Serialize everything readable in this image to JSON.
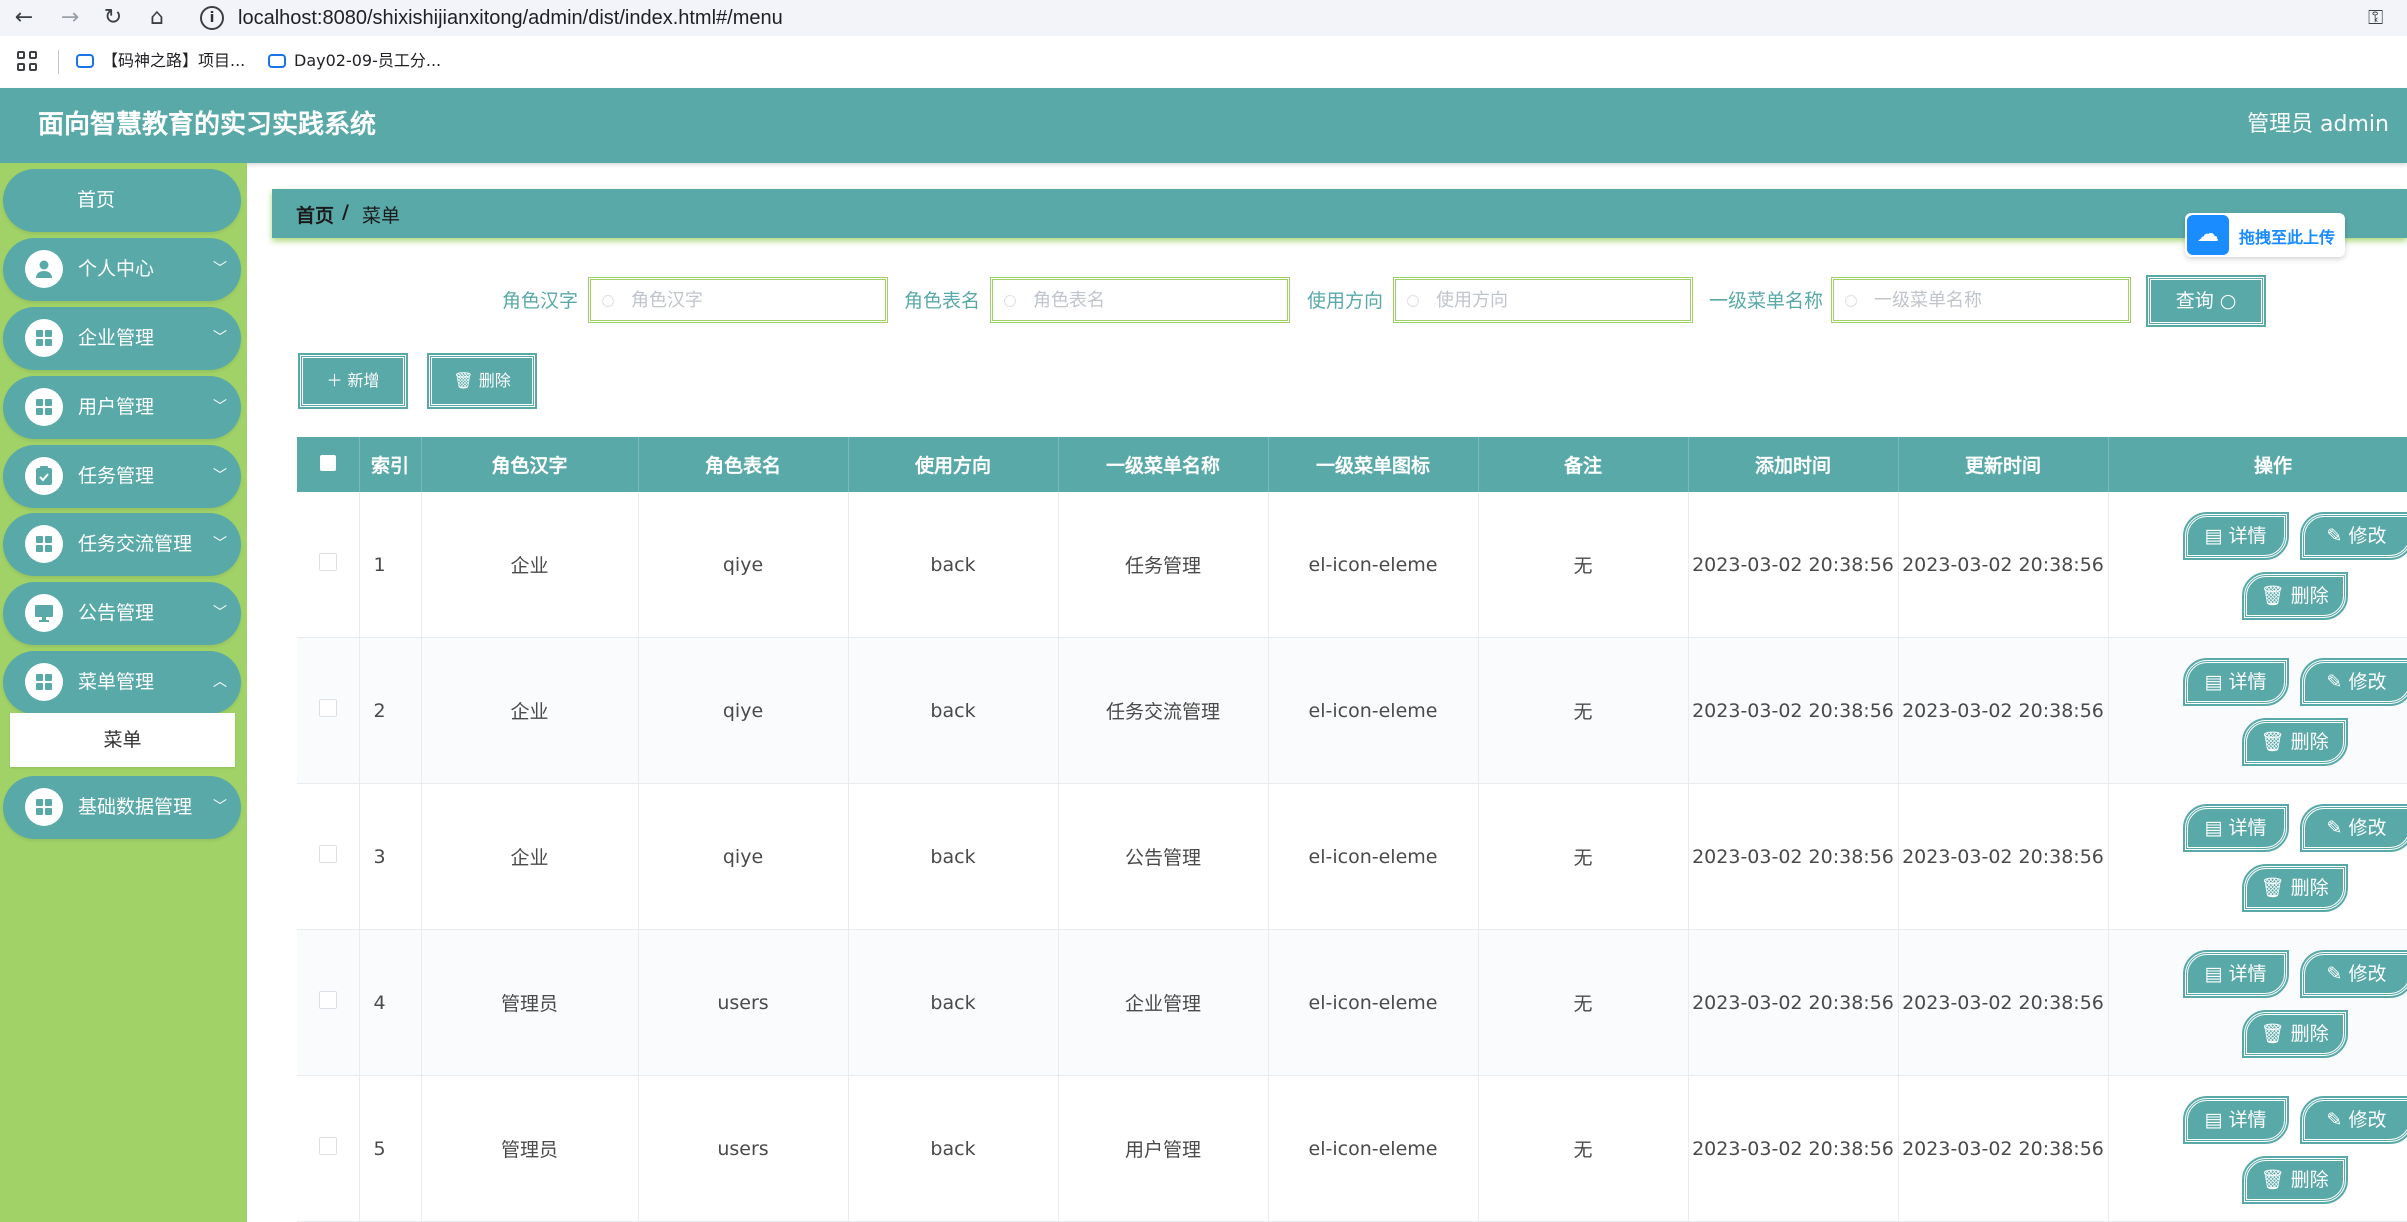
{
  "browser": {
    "url": "localhost:8080/shixishijianxitong/admin/dist/index.html#/menu",
    "bookmarks": [
      "【码神之路】项目...",
      "Day02-09-员工分..."
    ]
  },
  "header": {
    "title": "面向智慧教育的实习实践系统",
    "user": "管理员 admin"
  },
  "sidebar": {
    "home": "首页",
    "items": [
      {
        "label": "个人中心",
        "icon": "user-icon"
      },
      {
        "label": "企业管理",
        "icon": "grid-icon"
      },
      {
        "label": "用户管理",
        "icon": "grid-icon"
      },
      {
        "label": "任务管理",
        "icon": "clipboard-icon"
      },
      {
        "label": "任务交流管理",
        "icon": "grid-icon"
      },
      {
        "label": "公告管理",
        "icon": "monitor-icon"
      },
      {
        "label": "菜单管理",
        "icon": "grid-icon"
      },
      {
        "label": "基础数据管理",
        "icon": "grid-icon"
      }
    ],
    "active_sub": "菜单"
  },
  "breadcrumb": {
    "home": "首页",
    "sep": "/",
    "current": "菜单"
  },
  "upload": {
    "label": "拖拽至此上传"
  },
  "search": {
    "fields": [
      {
        "label": "角色汉字",
        "placeholder": "角色汉字"
      },
      {
        "label": "角色表名",
        "placeholder": "角色表名"
      },
      {
        "label": "使用方向",
        "placeholder": "使用方向"
      },
      {
        "label": "一级菜单名称",
        "placeholder": "一级菜单名称"
      }
    ],
    "button": "查询 ○"
  },
  "toolbar": {
    "add": "＋ 新增",
    "delete": "🗑 删除"
  },
  "table": {
    "headers": [
      "",
      "索引",
      "角色汉字",
      "角色表名",
      "使用方向",
      "一级菜单名称",
      "一级菜单图标",
      "备注",
      "添加时间",
      "更新时间",
      "操作"
    ],
    "rows": [
      {
        "index": "1",
        "role": "企业",
        "table": "qiye",
        "direction": "back",
        "menu": "任务管理",
        "icon": "el-icon-eleme",
        "remark": "无",
        "created": "2023-03-02 20:38:56",
        "updated": "2023-03-02 20:38:56"
      },
      {
        "index": "2",
        "role": "企业",
        "table": "qiye",
        "direction": "back",
        "menu": "任务交流管理",
        "icon": "el-icon-eleme",
        "remark": "无",
        "created": "2023-03-02 20:38:56",
        "updated": "2023-03-02 20:38:56"
      },
      {
        "index": "3",
        "role": "企业",
        "table": "qiye",
        "direction": "back",
        "menu": "公告管理",
        "icon": "el-icon-eleme",
        "remark": "无",
        "created": "2023-03-02 20:38:56",
        "updated": "2023-03-02 20:38:56"
      },
      {
        "index": "4",
        "role": "管理员",
        "table": "users",
        "direction": "back",
        "menu": "企业管理",
        "icon": "el-icon-eleme",
        "remark": "无",
        "created": "2023-03-02 20:38:56",
        "updated": "2023-03-02 20:38:56"
      },
      {
        "index": "5",
        "role": "管理员",
        "table": "users",
        "direction": "back",
        "menu": "用户管理",
        "icon": "el-icon-eleme",
        "remark": "无",
        "created": "2023-03-02 20:38:56",
        "updated": "2023-03-02 20:38:56"
      }
    ],
    "actions": {
      "detail": "▤ 详情",
      "edit": "✎ 修改",
      "delete": "🗑 删除"
    }
  },
  "colors": {
    "primary": "#5aa9a9",
    "sidebar": "#a1d267",
    "upload": "#1a8cff"
  }
}
